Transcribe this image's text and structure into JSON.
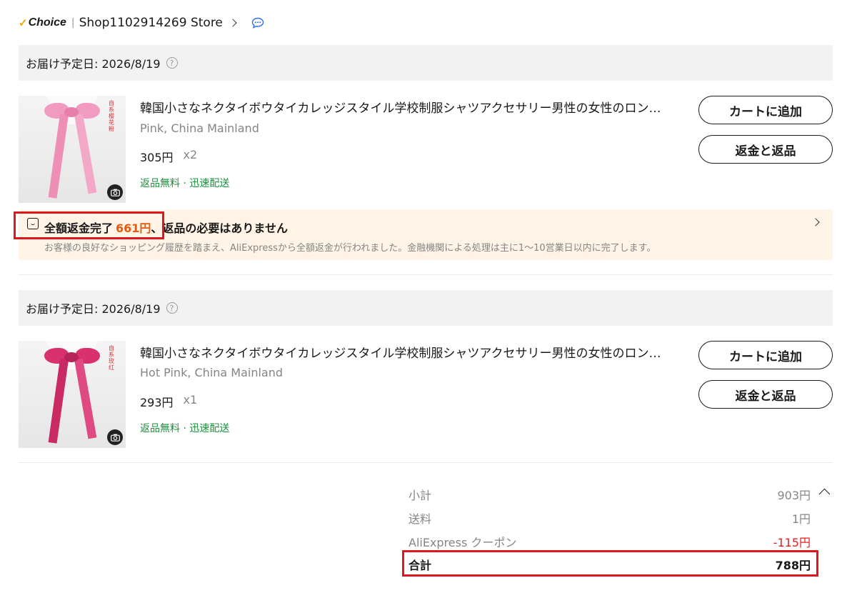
{
  "store": {
    "choice_label": "Choice",
    "name": "Shop1102914269 Store"
  },
  "orders": [
    {
      "delivery": "お届け予定日: 2026/8/19",
      "title": "韓国小さなネクタイボウタイカレッジスタイル学校制服シャツアクセサリー男性の女性のロン…",
      "variant": "Pink, China Mainland",
      "price": "305円",
      "qty": "x2",
      "tags": "返品無料 · 迅速配送",
      "image_label": "自系樱花粉",
      "bow_color": "#f29bc0",
      "buttons": {
        "add_to_cart": "カートに追加",
        "refund": "返金と返品"
      }
    },
    {
      "delivery": "お届け予定日: 2026/8/19",
      "title": "韓国小さなネクタイボウタイカレッジスタイル学校制服シャツアクセサリー男性の女性のロン…",
      "variant": "Hot Pink, China Mainland",
      "price": "293円",
      "qty": "x1",
      "tags": "返品無料 · 迅速配送",
      "image_label": "自系玫红",
      "bow_color": "#d9306e",
      "buttons": {
        "add_to_cart": "カートに追加",
        "refund": "返金と返品"
      }
    }
  ],
  "refund_notice": {
    "prefix": "全額返金完了",
    "amount": "661円",
    "suffix": "、返品の必要はありません",
    "description": "お客様の良好なショッピング履歴を踏まえ、AliExpressから全額返金が行われました。金融機関による処理は主に1〜10営業日以内に完了します。"
  },
  "summary": {
    "subtotal_label": "小計",
    "subtotal_value": "903円",
    "shipping_label": "送料",
    "shipping_value": "1円",
    "coupon_label": "AliExpress クーポン",
    "coupon_value": "-115円",
    "total_label": "合計",
    "total_value": "788円"
  },
  "colors": {
    "accent_orange": "#e8590c",
    "tag_green": "#1c8f3c",
    "discount_red": "#e02020",
    "highlight_red": "#e0161e",
    "choice_check": "#f7a600"
  }
}
